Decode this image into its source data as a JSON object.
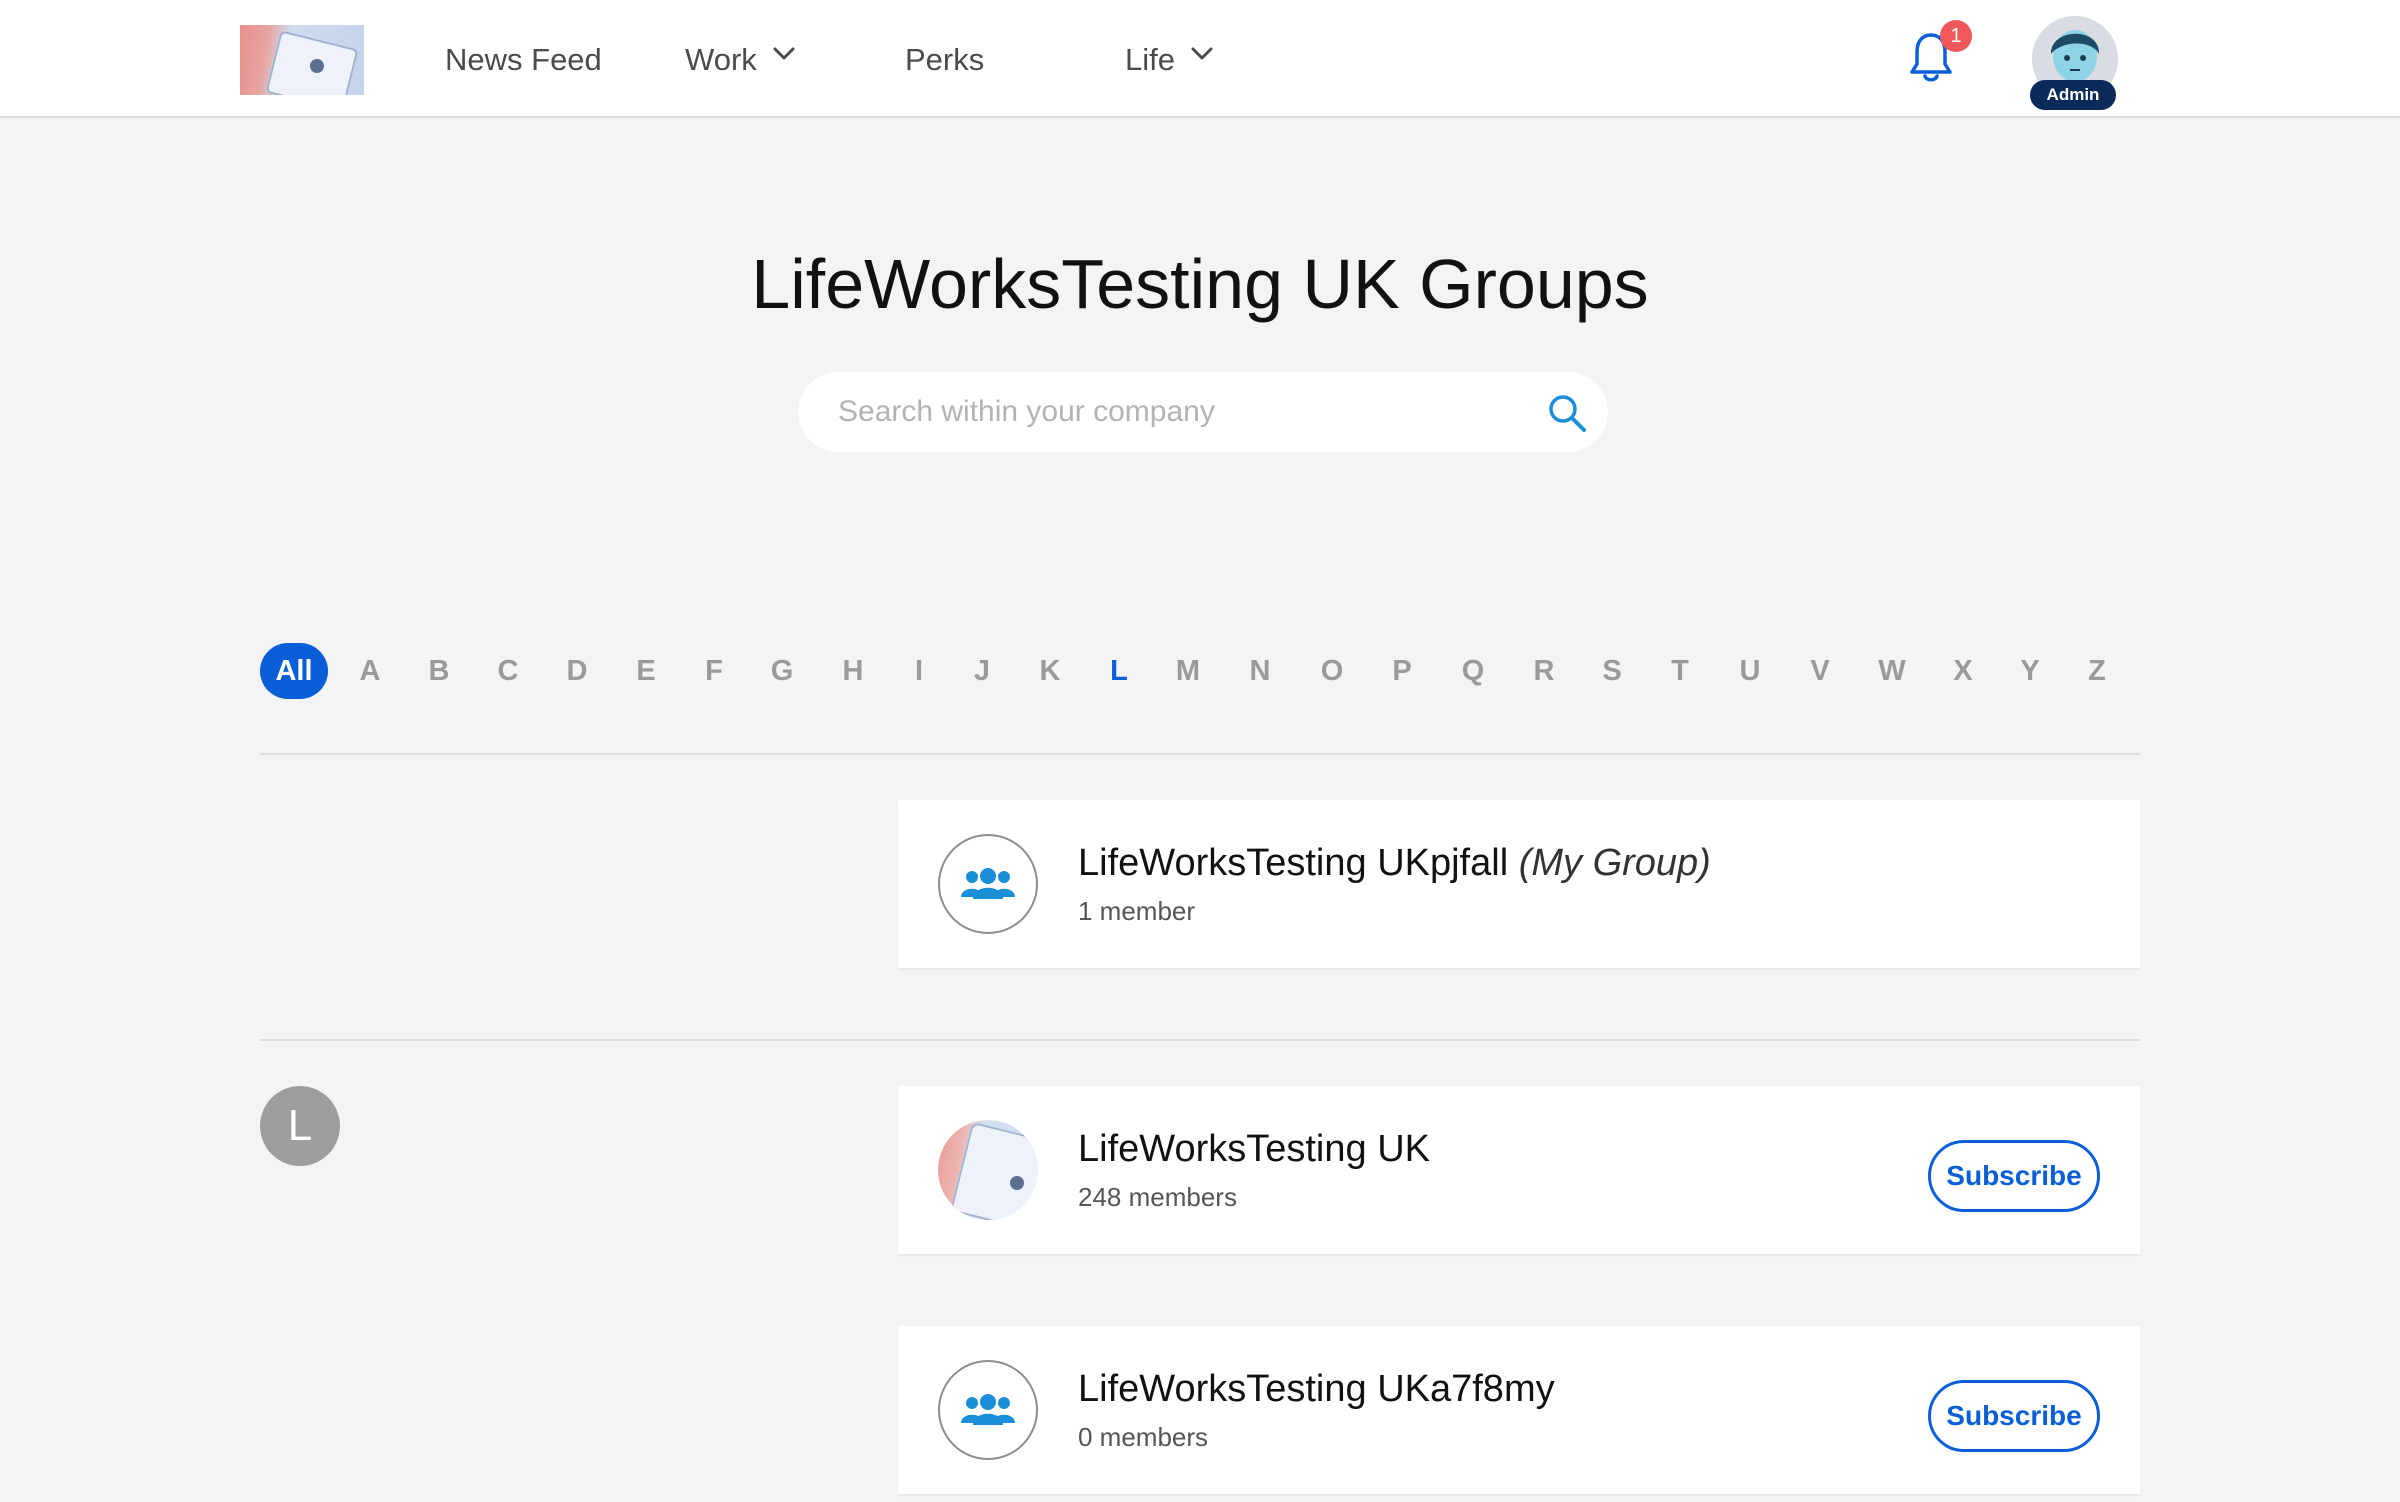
{
  "nav": {
    "items": [
      {
        "label": "News Feed",
        "has_dropdown": false
      },
      {
        "label": "Work",
        "has_dropdown": true
      },
      {
        "label": "Perks",
        "has_dropdown": false
      },
      {
        "label": "Life",
        "has_dropdown": true
      }
    ],
    "notification_count": "1",
    "user_role_badge": "Admin",
    "icons": {
      "notifications": "bell-icon",
      "dropdown": "chevron-down-icon"
    }
  },
  "page": {
    "title": "LifeWorksTesting UK Groups",
    "search_placeholder": "Search within your company"
  },
  "alphabet": {
    "all_label": "All",
    "letters": [
      "A",
      "B",
      "C",
      "D",
      "E",
      "F",
      "G",
      "H",
      "I",
      "J",
      "K",
      "L",
      "M",
      "N",
      "O",
      "P",
      "Q",
      "R",
      "S",
      "T",
      "U",
      "V",
      "W",
      "X",
      "Y",
      "Z"
    ],
    "selected": "All",
    "highlighted_letter": "L"
  },
  "my_groups": [
    {
      "name": "LifeWorksTesting UKpjfall",
      "tag": "(My Group)",
      "members": "1 member"
    }
  ],
  "section_letter": "L",
  "groups": [
    {
      "name": "LifeWorksTesting UK",
      "members": "248 members",
      "action": "Subscribe",
      "has_photo": true
    },
    {
      "name": "LifeWorksTesting UKa7f8my",
      "members": "0 members",
      "action": "Subscribe",
      "has_photo": false
    }
  ],
  "colors": {
    "accent": "#0a5fd8",
    "badge": "#f0595c",
    "background": "#f4f4f4",
    "admin_badge": "#0a2a5a"
  }
}
